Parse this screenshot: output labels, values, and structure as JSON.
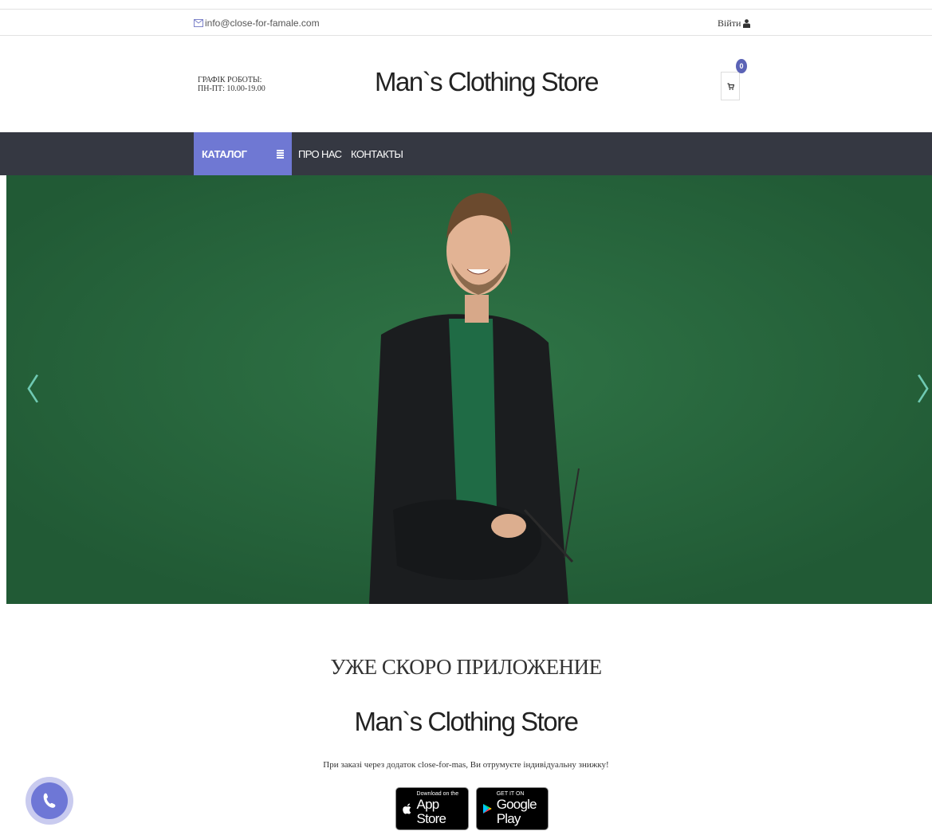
{
  "topbar": {
    "email": "info@close-for-famale.com",
    "login": "Війти"
  },
  "header": {
    "hours_title": "ГРАФІК РОБОТЫ:",
    "hours_value": "ПН-ПТ: 10.00-19.00",
    "logo": "Man`s Clothing Store",
    "cart_count": "0"
  },
  "nav": {
    "catalog": "КАТАЛОГ",
    "about": "ПРО НАС",
    "contacts": "КОНТАКТЫ"
  },
  "hero": {
    "prev_arrow": "〈",
    "next_arrow": "〉"
  },
  "app_promo": {
    "title": "УЖЕ СКОРО ПРИЛОЖЕНИЕ",
    "brand": "Man`s Clothing Store",
    "text": "При заказі через додаток close-for-mas, Ви отрумуєте індивідуальну знижку!",
    "appstore_small": "Download on the",
    "appstore_big": "App Store",
    "googleplay_small": "GET IT ON",
    "googleplay_big": "Google Play"
  },
  "colors": {
    "nav_bg": "#353842",
    "accent": "#6f78d3",
    "badge": "#5b63b6",
    "hero_green": "#2a6b3f"
  }
}
